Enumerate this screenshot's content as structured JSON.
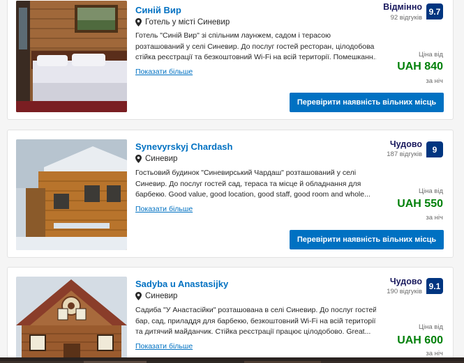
{
  "listings": [
    {
      "name": "Синій Вир",
      "location": "Готель у місті Синевир",
      "description_lines": [
        "Готель \"Синій Вир\" зі спільним лаунжем, садом і терасою",
        "розташований у селі Синевир. До послуг гостей ресторан, цілодобова",
        "стійка реєстрації та безкоштовний Wi-Fi на всій території. Помешканн..."
      ],
      "more_link": "Показати більше",
      "rating_word": "Відмінно",
      "reviews": "92 відгуків",
      "score": "9.7",
      "price_from": "Ціна від",
      "price": "UAH 840",
      "per_night": "за ніч",
      "button": "Перевірити наявність вільних місць"
    },
    {
      "name": "Synevyrskyj Chardash",
      "location": "Синевир",
      "description_lines": [
        "Гостьовий будинок \"Синевирський Чардаш\" розташований у селі",
        "Синевир. До послуг гостей сад, тераса та місце й обладнання для",
        "барбекю. Good value, good location, good staff, good room and whole..."
      ],
      "more_link": "Показати більше",
      "rating_word": "Чудово",
      "reviews": "187 відгуків",
      "score": "9",
      "price_from": "Ціна від",
      "price": "UAH 550",
      "per_night": "за ніч",
      "button": "Перевірити наявність вільних місць"
    },
    {
      "name": "Sadyba u Anastasijky",
      "location": "Синевир",
      "description_lines": [
        "Садиба \"У Анастасійки\" розташована в селі Синевир. До послуг гостей",
        "бар, сад, приладдя для барбекю, безкоштовний Wi-Fi на всій території",
        "та дитячий майданчик. Стійка реєстрації працює цілодобово. Great..."
      ],
      "more_link": "Показати більше",
      "rating_word": "Чудово",
      "reviews": "190 відгуків",
      "score": "9.1",
      "price_from": "Ціна від",
      "price": "UAH 600",
      "per_night": "за ніч"
    }
  ],
  "icons": {
    "location": "map-pin-icon"
  },
  "colors": {
    "link_blue": "#0071c2",
    "score_navy": "#003580",
    "price_green": "#008009",
    "rating_text": "#1a1a5e"
  }
}
